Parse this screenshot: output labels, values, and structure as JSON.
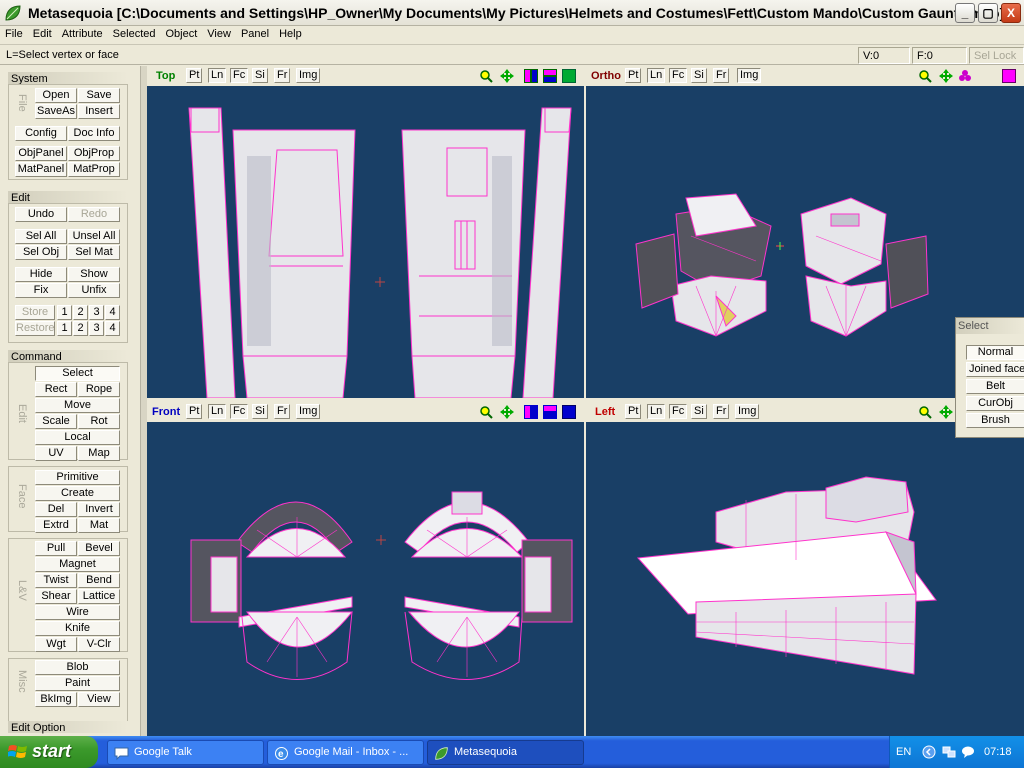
{
  "window": {
    "title": "Metasequoia [C:\\Documents and Settings\\HP_Owner\\My Documents\\My Pictures\\Helmets and Costumes\\Fett\\Custom Mando\\Custom Gaunts.mqo]",
    "minimize": "_",
    "restore": "▢",
    "close": "X"
  },
  "menu": [
    "File",
    "Edit",
    "Attribute",
    "Selected",
    "Object",
    "View",
    "Panel",
    "Help"
  ],
  "status": {
    "hint": "L=Select vertex or face",
    "vertex": "V:0",
    "face": "F:0",
    "sel_lock": "Sel Lock"
  },
  "panel": {
    "system": {
      "header": "System",
      "side_label": "File",
      "open": "Open",
      "save": "Save",
      "saveas": "SaveAs",
      "insert": "Insert",
      "config": "Config",
      "docinfo": "Doc Info",
      "objpanel": "ObjPanel",
      "objprop": "ObjProp",
      "matpanel": "MatPanel",
      "matprop": "MatProp"
    },
    "edit": {
      "header": "Edit",
      "undo": "Undo",
      "redo": "Redo",
      "selall": "Sel All",
      "unselall": "Unsel All",
      "selobj": "Sel Obj",
      "selmat": "Sel Mat",
      "hide": "Hide",
      "show": "Show",
      "fix": "Fix",
      "unfix": "Unfix",
      "store": "Store",
      "restore": "Restore",
      "n1": "1",
      "n2": "2",
      "n3": "3",
      "n4": "4"
    },
    "command": {
      "header": "Command",
      "label_edit": "Edit",
      "label_face": "Face",
      "label_lv": "L&V",
      "label_misc": "Misc",
      "select": "Select",
      "rect": "Rect",
      "rope": "Rope",
      "move": "Move",
      "scale": "Scale",
      "rot": "Rot",
      "local": "Local",
      "uv": "UV",
      "map": "Map",
      "primitive": "Primitive",
      "create": "Create",
      "del": "Del",
      "invert": "Invert",
      "extrd": "Extrd",
      "mat": "Mat",
      "pull": "Pull",
      "bevel": "Bevel",
      "magnet": "Magnet",
      "twist": "Twist",
      "bend": "Bend",
      "shear": "Shear",
      "lattice": "Lattice",
      "wire": "Wire",
      "knife": "Knife",
      "wgt": "Wgt",
      "vclr": "V-Clr",
      "blob": "Blob",
      "paint": "Paint",
      "bkimg": "BkImg",
      "view": "View"
    },
    "editoption": {
      "header": "Edit Option"
    }
  },
  "viewports": {
    "top": {
      "name": "Top",
      "color": "#008000"
    },
    "ortho": {
      "name": "Ortho",
      "color": "#800000"
    },
    "front": {
      "name": "Front",
      "color": "#0000c0"
    },
    "left": {
      "name": "Left",
      "color": "#c00000"
    },
    "modes": {
      "pt": "Pt",
      "ln": "Ln",
      "fc": "Fc",
      "si": "Si",
      "fr": "Fr",
      "img": "Img"
    }
  },
  "select_panel": {
    "header": "Select",
    "items": [
      "Normal",
      "Joined face",
      "Belt",
      "CurObj",
      "Brush"
    ]
  },
  "taskbar": {
    "start": "start",
    "tasks": [
      "Google Talk",
      "Google Mail - Inbox - ...",
      "Metasequoia"
    ],
    "lang": "EN",
    "clock": "07:18"
  },
  "colors": {
    "viewport_bg": "#193f66",
    "wire": "#ff44cc",
    "taskbar": "#245edb"
  }
}
